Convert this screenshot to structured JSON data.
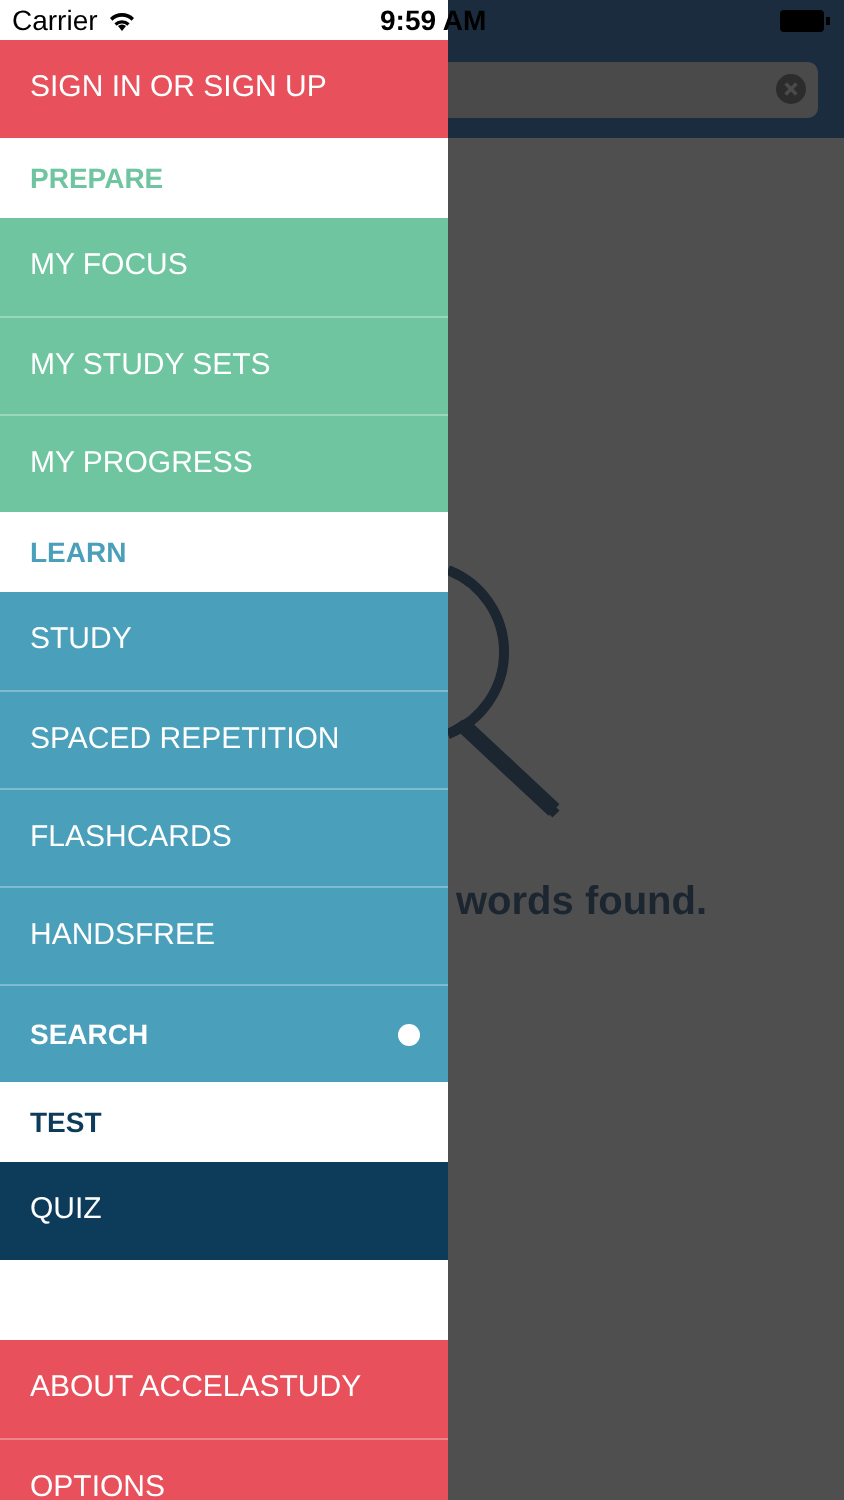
{
  "status_bar": {
    "carrier": "Carrier",
    "time": "9:59 AM"
  },
  "account_button": {
    "label": "SIGN IN OR SIGN UP"
  },
  "sections": [
    {
      "title": "PREPARE",
      "color": "#6ec5a0",
      "items": [
        {
          "label": "MY FOCUS",
          "selected": false
        },
        {
          "label": "MY STUDY SETS",
          "selected": false
        },
        {
          "label": "MY PROGRESS",
          "selected": false
        }
      ]
    },
    {
      "title": "LEARN",
      "color": "#4a9fba",
      "items": [
        {
          "label": "STUDY",
          "selected": false
        },
        {
          "label": "SPACED REPETITION",
          "selected": false
        },
        {
          "label": "FLASHCARDS",
          "selected": false
        },
        {
          "label": "HANDSFREE",
          "selected": false
        },
        {
          "label": "SEARCH",
          "selected": true
        }
      ]
    },
    {
      "title": "TEST",
      "color": "#0d3b5a",
      "items": [
        {
          "label": "QUIZ",
          "selected": false
        }
      ]
    }
  ],
  "footer_items": [
    {
      "label": "ABOUT ACCELASTUDY"
    },
    {
      "label": "OPTIONS"
    }
  ],
  "empty_state": {
    "message": "words found."
  }
}
